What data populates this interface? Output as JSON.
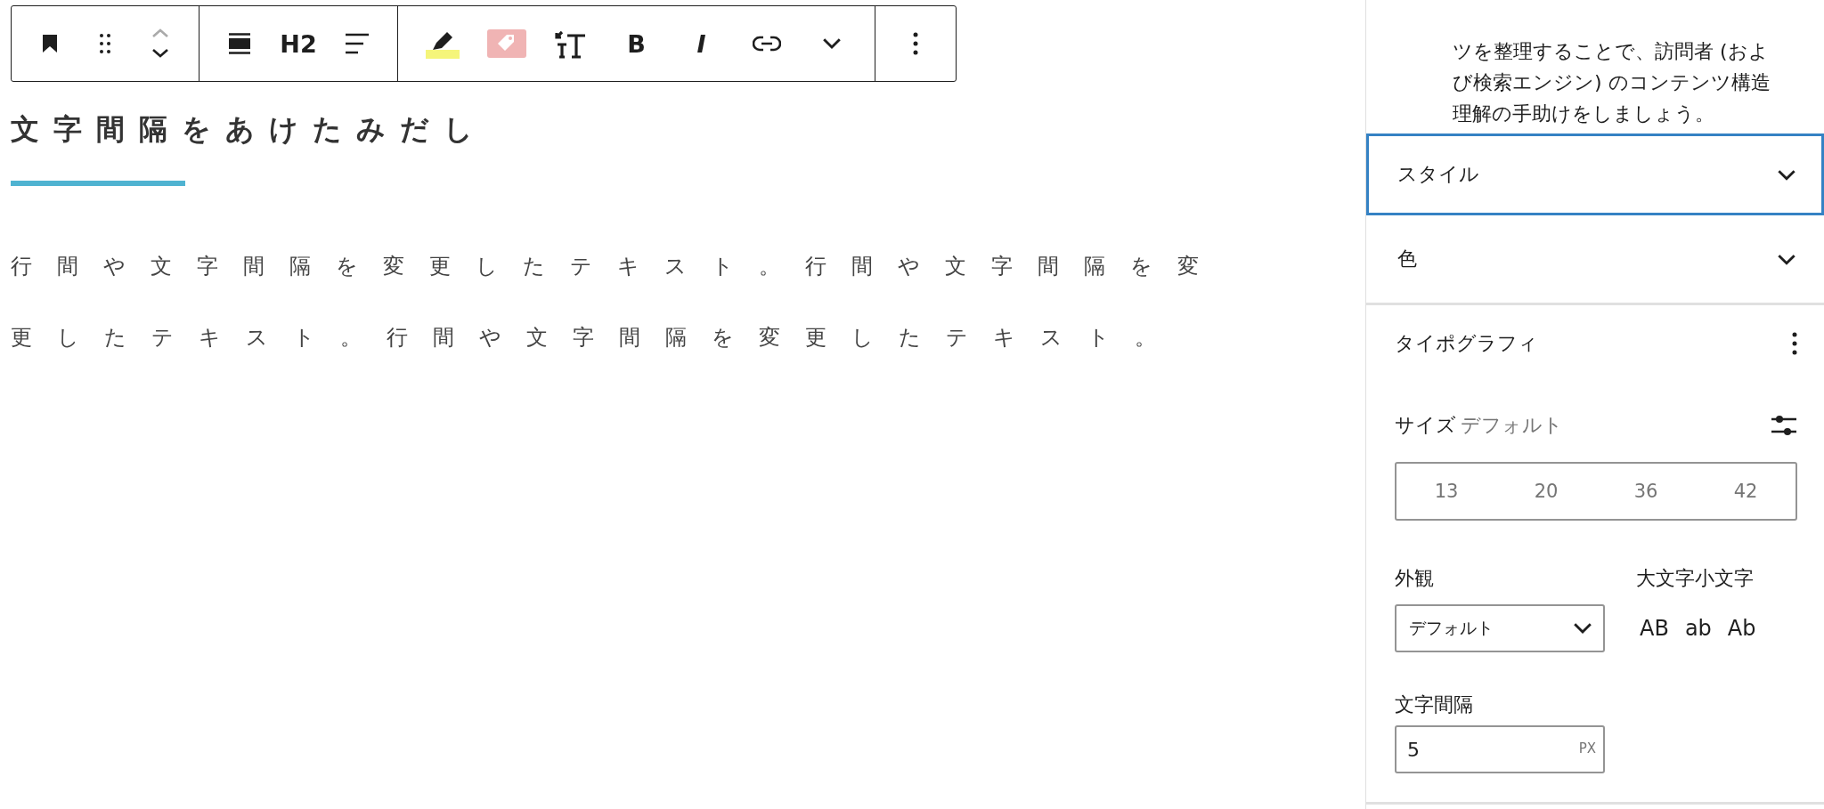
{
  "toolbar": {
    "groups": [
      {
        "items": [
          {
            "kind": "bookmark"
          },
          {
            "kind": "drag"
          },
          {
            "kind": "mover"
          }
        ]
      },
      {
        "items": [
          {
            "kind": "wide"
          },
          {
            "kind": "text",
            "label": "H2"
          },
          {
            "kind": "align"
          }
        ]
      },
      {
        "items": [
          {
            "kind": "highlight"
          },
          {
            "kind": "tag"
          },
          {
            "kind": "textsize"
          },
          {
            "kind": "bold",
            "label": "B"
          },
          {
            "kind": "italic",
            "label": "I"
          },
          {
            "kind": "link"
          },
          {
            "kind": "chevron"
          }
        ]
      },
      {
        "items": [
          {
            "kind": "more"
          }
        ]
      }
    ]
  },
  "editor": {
    "heading": "文字間隔をあけたみだし",
    "paragraph": "行間や文字間隔を変更したテキスト。行間や文字間隔を変更したテキスト。行間や文字間隔を変更したテキスト。"
  },
  "sidebar": {
    "description": "ツを整理することで、訪問者 (および検索エンジン) のコンテンツ構造理解の手助けをしましょう。",
    "panels": [
      {
        "title": "スタイル",
        "expanded": false,
        "focused": true
      },
      {
        "title": "色",
        "expanded": false,
        "focused": false
      }
    ],
    "typography": {
      "title": "タイポグラフィ",
      "size_label": "サイズ",
      "size_value": "デフォルト",
      "sizes": [
        {
          "label": "13",
          "selected": false
        },
        {
          "label": "20",
          "selected": false
        },
        {
          "label": "36",
          "selected": false
        },
        {
          "label": "42",
          "selected": false
        }
      ],
      "appearance_label": "外観",
      "appearance_value": "デフォルト",
      "case_label": "大文字小文字",
      "cases": [
        {
          "label": "AB",
          "selected": false
        },
        {
          "label": "ab",
          "selected": false
        },
        {
          "label": "Ab",
          "selected": false
        }
      ],
      "spacing_label": "文字間隔",
      "spacing_value": "5",
      "spacing_unit": "PX"
    }
  }
}
